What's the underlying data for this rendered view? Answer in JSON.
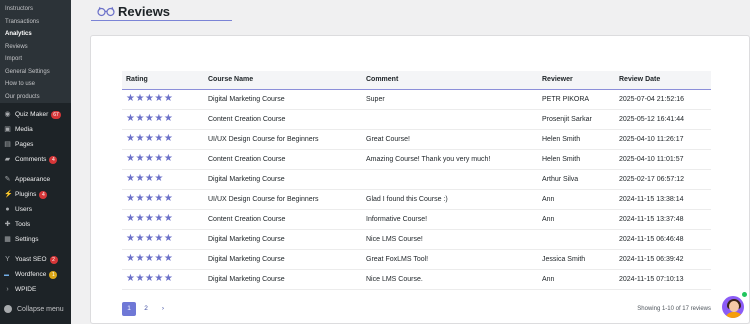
{
  "sidebar": {
    "sub_items": [
      {
        "label": "Instructors",
        "active": false
      },
      {
        "label": "Transactions",
        "active": false
      },
      {
        "label": "Analytics",
        "active": true
      },
      {
        "label": "Reviews",
        "active": false
      },
      {
        "label": "Import",
        "active": false
      },
      {
        "label": "General Settings",
        "active": false
      },
      {
        "label": "How to use",
        "active": false
      },
      {
        "label": "Our products",
        "active": false
      }
    ],
    "menu": {
      "quiz_maker": {
        "label": "Quiz Maker",
        "badge": "67"
      },
      "media": {
        "label": "Media"
      },
      "pages": {
        "label": "Pages"
      },
      "comments": {
        "label": "Comments",
        "badge": "4"
      },
      "appearance": {
        "label": "Appearance"
      },
      "plugins": {
        "label": "Plugins",
        "badge": "4"
      },
      "users": {
        "label": "Users"
      },
      "tools": {
        "label": "Tools"
      },
      "settings": {
        "label": "Settings"
      },
      "yoast": {
        "label": "Yoast SEO",
        "badge": "2"
      },
      "wordfence": {
        "label": "Wordfence",
        "badge": "1"
      },
      "wpide": {
        "label": "WPIDE"
      }
    },
    "collapse_label": "Collapse menu"
  },
  "header": {
    "title": "Reviews",
    "icon": "glasses-icon"
  },
  "table": {
    "columns": [
      "Rating",
      "Course Name",
      "Comment",
      "Reviewer",
      "Review Date"
    ],
    "rows": [
      {
        "rating": 5,
        "course": "Digital Marketing Course",
        "comment": "Super",
        "reviewer": "PETR PIKORA",
        "date": "2025-07-04 21:52:16"
      },
      {
        "rating": 5,
        "course": "Content Creation Course",
        "comment": "",
        "reviewer": "Prosenjit Sarkar",
        "date": "2025-05-12 16:41:44"
      },
      {
        "rating": 5,
        "course": "UI/UX Design Course for Beginners",
        "comment": "Great Course!",
        "reviewer": "Helen Smith",
        "date": "2025-04-10 11:26:17"
      },
      {
        "rating": 5,
        "course": "Content Creation Course",
        "comment": "Amazing Course! Thank you very much!",
        "reviewer": "Helen Smith",
        "date": "2025-04-10 11:01:57"
      },
      {
        "rating": 4,
        "course": "Digital Marketing Course",
        "comment": "",
        "reviewer": "Arthur Silva",
        "date": "2025-02-17 06:57:12"
      },
      {
        "rating": 5,
        "course": "UI/UX Design Course for Beginners",
        "comment": "Glad I found this Course :)",
        "reviewer": "Ann",
        "date": "2024-11-15 13:38:14"
      },
      {
        "rating": 5,
        "course": "Content Creation Course",
        "comment": "Informative Course!",
        "reviewer": "Ann",
        "date": "2024-11-15 13:37:48"
      },
      {
        "rating": 5,
        "course": "Digital Marketing Course",
        "comment": "Nice LMS Course!",
        "reviewer": "",
        "date": "2024-11-15 06:46:48"
      },
      {
        "rating": 5,
        "course": "Digital Marketing Course",
        "comment": "Great FoxLMS Tool!",
        "reviewer": "Jessica Smith",
        "date": "2024-11-15 06:39:42"
      },
      {
        "rating": 5,
        "course": "Digital Marketing Course",
        "comment": "Nice LMS Course.",
        "reviewer": "Ann",
        "date": "2024-11-15 07:10:13"
      }
    ]
  },
  "pagination": {
    "pages": [
      "1",
      "2"
    ],
    "current": "1",
    "next": "›",
    "showing": "Showing 1-10 of 17 reviews"
  },
  "colors": {
    "accent": "#6c71c9",
    "sidebar_bg": "#1d2327",
    "badge_red": "#d63638"
  }
}
